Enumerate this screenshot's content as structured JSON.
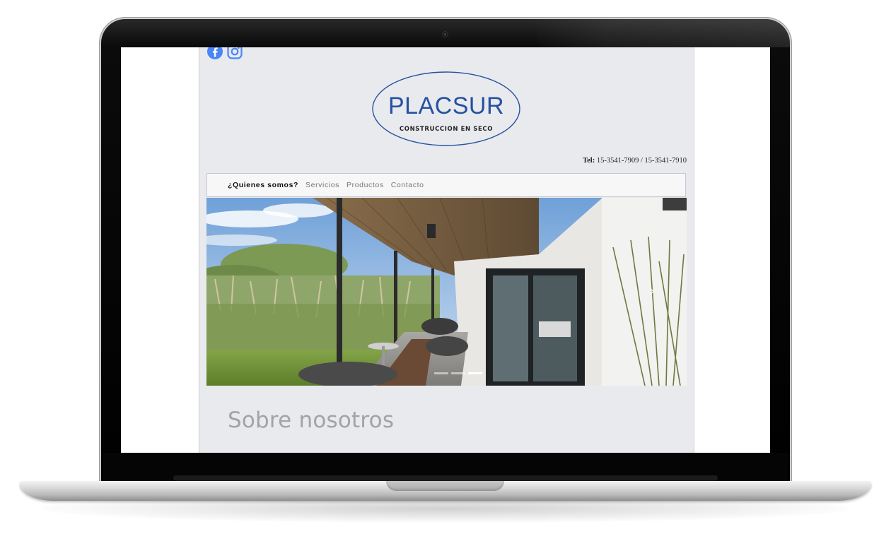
{
  "brand": {
    "name": "PLACSUR",
    "tagline": "CONSTRUCCION EN SECO",
    "accent_color": "#2552a0"
  },
  "social": {
    "icons": [
      "facebook-icon",
      "instagram-icon"
    ],
    "color": "#4a86f7"
  },
  "contact": {
    "tel_label": "Tel:",
    "tel_numbers": "15-3541-7909 / 15-3541-7910"
  },
  "nav": {
    "items": [
      {
        "label": "¿Quienes somos?",
        "active": true
      },
      {
        "label": "Servicios",
        "active": false
      },
      {
        "label": "Productos",
        "active": false
      },
      {
        "label": "Contacto",
        "active": false
      }
    ]
  },
  "carousel": {
    "next_icon": "chevron-right-icon",
    "slide_count": 3,
    "active_slide": 3
  },
  "section": {
    "title": "Sobre nosotros"
  }
}
